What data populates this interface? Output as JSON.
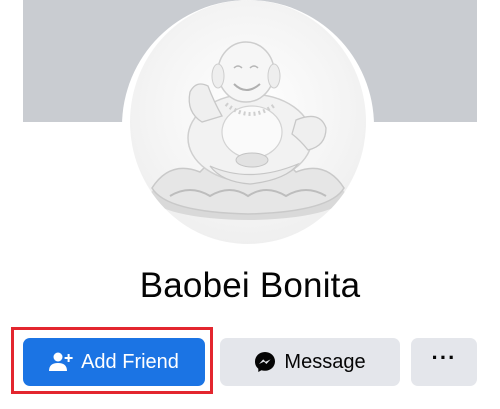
{
  "profile": {
    "name": "Baobei Bonita",
    "avatar_icon": "laughing-buddha-statue-photo"
  },
  "actions": {
    "add_friend_label": "Add Friend",
    "message_label": "Message",
    "more_label": "···"
  },
  "colors": {
    "cover": "#c9ccd1",
    "primary_button": "#1b74e4",
    "secondary_button": "#e4e6eb",
    "highlight_border": "#e3262e",
    "text": "#050505"
  },
  "icons": {
    "add_friend": "person-plus-icon",
    "message": "messenger-icon",
    "more": "more-dots-icon"
  }
}
